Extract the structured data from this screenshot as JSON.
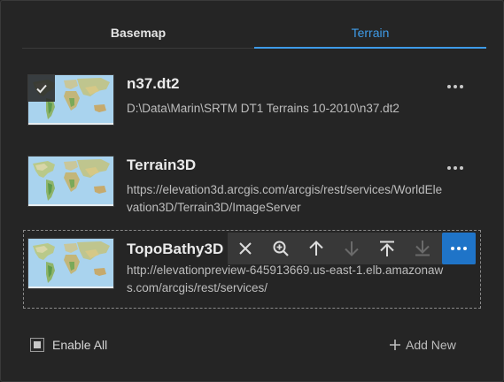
{
  "tabs": [
    {
      "label": "Basemap",
      "active": false
    },
    {
      "label": "Terrain",
      "active": true
    }
  ],
  "items": [
    {
      "title": "n37.dt2",
      "path": "D:\\Data\\Marin\\SRTM DT1 Terrains 10-2010\\n37.dt2",
      "checked": true
    },
    {
      "title": "Terrain3D",
      "path": "https://elevation3d.arcgis.com/arcgis/rest/services/WorldElevation3D/Terrain3D/ImageServer",
      "checked": false
    },
    {
      "title": "TopoBathy3D",
      "path": "http://elevationpreview-645913669.us-east-1.elb.amazonaws.com/arcgis/rest/services/",
      "checked": false,
      "selected": true
    }
  ],
  "toolbar": [
    "close-icon",
    "zoom-to-icon",
    "move-up-icon",
    "move-down-icon",
    "move-top-icon",
    "move-bottom-icon",
    "more-icon"
  ],
  "footer": {
    "enable_all_label": "Enable All",
    "add_new_label": "Add New"
  },
  "colors": {
    "accent": "#3e9be8",
    "active_button": "#1f74c8",
    "background": "#252525"
  }
}
